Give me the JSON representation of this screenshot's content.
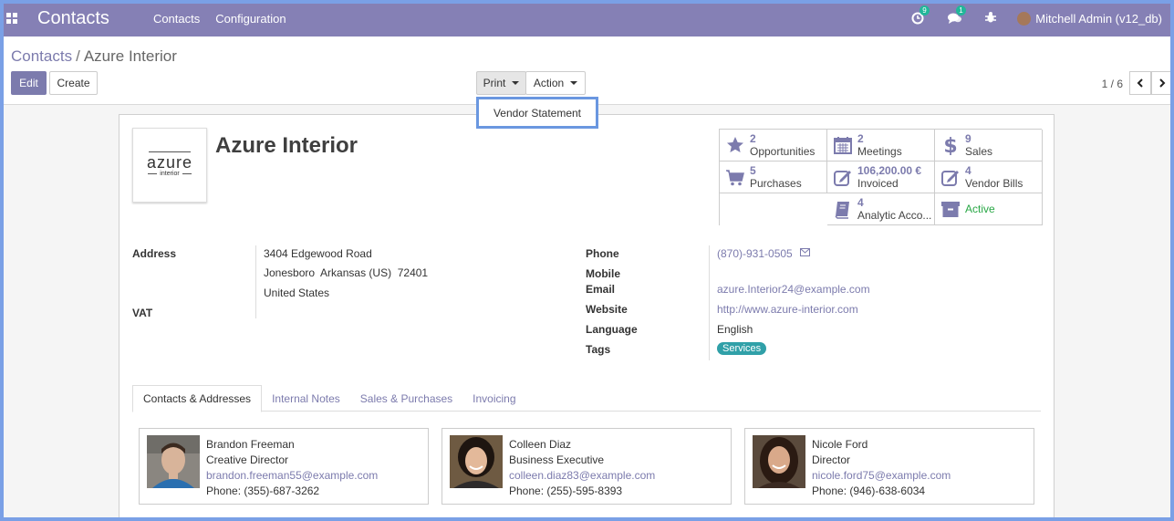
{
  "navbar": {
    "brand": "Contacts",
    "menu": [
      "Contacts",
      "Configuration"
    ],
    "activity_count": "9",
    "messages_count": "1",
    "user": "Mitchell Admin (v12_db)"
  },
  "breadcrumb": {
    "parent": "Contacts",
    "sep": "/",
    "current": "Azure Interior"
  },
  "buttons": {
    "edit": "Edit",
    "create": "Create",
    "print": "Print",
    "action": "Action"
  },
  "print_menu": {
    "items": [
      "Vendor Statement"
    ]
  },
  "pager": {
    "value": "1 / 6"
  },
  "record": {
    "name": "Azure Interior",
    "logo_main": "azure",
    "logo_sub": "interior"
  },
  "stats": [
    {
      "value": "2",
      "label": "Opportunities",
      "icon": "star-icon"
    },
    {
      "value": "2",
      "label": "Meetings",
      "icon": "calendar-icon"
    },
    {
      "value": "9",
      "label": "Sales",
      "icon": "dollar-icon"
    },
    {
      "value": "5",
      "label": "Purchases",
      "icon": "cart-icon"
    },
    {
      "value": "106,200.00 €",
      "label": "Invoiced",
      "icon": "pencil-square-icon"
    },
    {
      "value": "4",
      "label": "Vendor Bills",
      "icon": "pencil-square-icon"
    },
    {
      "value": "4",
      "label": "Analytic Acco...",
      "icon": "book-icon"
    },
    {
      "value": "",
      "label": "Active",
      "icon": "archive-icon"
    }
  ],
  "fields": {
    "address_label": "Address",
    "address_line1": "3404 Edgewood Road",
    "address_line2": "Jonesboro  Arkansas (US)  72401",
    "address_line3": "United States",
    "vat_label": "VAT",
    "phone_label": "Phone",
    "phone": "(870)-931-0505",
    "mobile_label": "Mobile",
    "email_label": "Email",
    "email": "azure.Interior24@example.com",
    "website_label": "Website",
    "website": "http://www.azure-interior.com",
    "language_label": "Language",
    "language": "English",
    "tags_label": "Tags",
    "tag": "Services"
  },
  "tabs": [
    "Contacts & Addresses",
    "Internal Notes",
    "Sales & Purchases",
    "Invoicing"
  ],
  "contacts": [
    {
      "name": "Brandon Freeman",
      "title": "Creative Director",
      "email": "brandon.freeman55@example.com",
      "phone": "Phone: (355)-687-3262"
    },
    {
      "name": "Colleen Diaz",
      "title": "Business Executive",
      "email": "colleen.diaz83@example.com",
      "phone": "Phone: (255)-595-8393"
    },
    {
      "name": "Nicole Ford",
      "title": "Director",
      "email": "nicole.ford75@example.com",
      "phone": "Phone: (946)-638-6034"
    }
  ],
  "colors": {
    "navbar": "#8580b5",
    "primary": "#7c7bad",
    "tag": "#30a0a8",
    "active": "#28a745"
  }
}
